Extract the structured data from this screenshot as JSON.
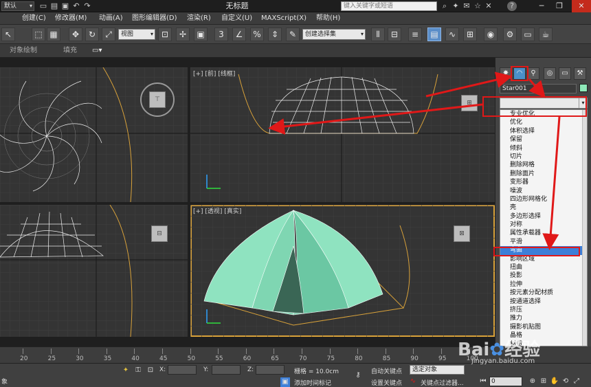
{
  "titlebar": {
    "workspace": "默认",
    "title": "无标题",
    "search_placeholder": "键入关键字或短语"
  },
  "menu": [
    "创建(C)",
    "修改器(M)",
    "动画(A)",
    "图形编辑器(D)",
    "渲染(R)",
    "自定义(U)",
    "MAXScript(X)",
    "帮助(H)"
  ],
  "toolbar": {
    "ref_coord": "视图",
    "named_selection": "创建选择集"
  },
  "ribbon": {
    "item1": "对象绘制",
    "item2": "填充"
  },
  "viewports": {
    "top_right_label": "[+] [前] [线框]",
    "bottom_right_label": "[+] [透视] [真实]"
  },
  "command_panel": {
    "object_name": "Star001",
    "modifier_list": [
      "专业优化",
      "优化",
      "体积选择",
      "保留",
      "倾斜",
      "切片",
      "删除网格",
      "删除面片",
      "变形器",
      "噪波",
      "四边形网格化",
      "壳",
      "多边形选择",
      "对称",
      "属性承载器",
      "平滑",
      "弯曲",
      "影响区域",
      "扭曲",
      "投影",
      "拉伸",
      "按元素分配材质",
      "按通道选择",
      "挤压",
      "推力",
      "摄影机贴图",
      "晶格",
      "材质",
      "涡轮平滑"
    ],
    "selected_modifier": "弯曲"
  },
  "timeline": {
    "ticks": [
      "20",
      "25",
      "30",
      "35",
      "40",
      "45",
      "50",
      "55",
      "60",
      "65",
      "70",
      "75",
      "80",
      "85",
      "90",
      "95",
      "100"
    ]
  },
  "status": {
    "left_text": "象",
    "x_label": "X:",
    "y_label": "Y:",
    "z_label": "Z:",
    "grid": "栅格 = 10.0cm",
    "add_time_tag": "添加时间标记",
    "auto_key": "自动关键点",
    "set_key": "设置关键点",
    "selected": "选定对象",
    "key_filters": "关键点过滤器...",
    "frame": "0"
  },
  "watermark": {
    "logo": "Bai",
    "brand": "经验",
    "url": "jingyan.baidu.com"
  },
  "colors": {
    "accent": "#d9a23a",
    "annotation": "#e01818",
    "selection": "#3d7fd8",
    "object": "#8ee8b8"
  }
}
